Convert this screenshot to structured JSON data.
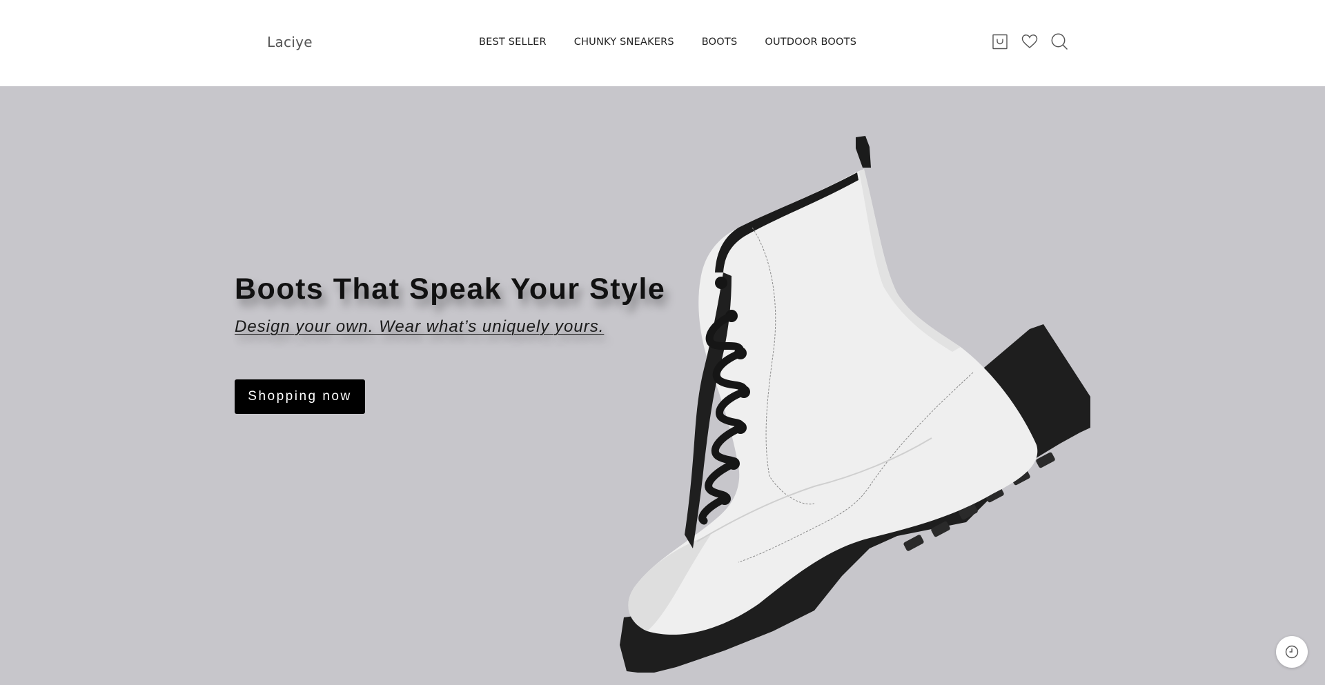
{
  "brand": {
    "name": "Laciye"
  },
  "nav": {
    "items": [
      "BEST SELLER",
      "CHUNKY SNEAKERS",
      "BOOTS",
      "OUTDOOR BOOTS"
    ]
  },
  "header_icons": [
    "cart-icon",
    "heart-icon",
    "search-icon"
  ],
  "hero": {
    "title": "Boots That Speak Your Style",
    "subtitle": "Design your own. Wear what’s uniquely yours.",
    "cta_label": "Shopping now",
    "background": "#c7c6cb"
  },
  "floating_button": {
    "icon": "history-clock-icon"
  },
  "colors": {
    "cta_bg": "#000000",
    "cta_text": "#ffffff",
    "header_bg": "#ffffff"
  }
}
